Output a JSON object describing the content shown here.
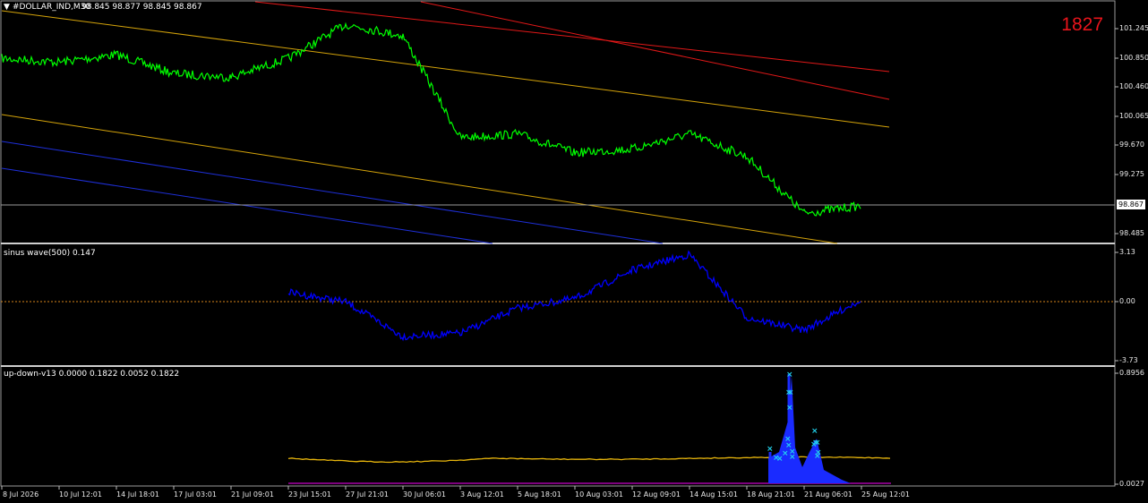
{
  "main_panel": {
    "title": "#DOLLAR_IND,M30",
    "ohlc": "98.845 98.877 98.845 98.867",
    "counter": "1827",
    "current_price": "98.867",
    "y_labels": [
      "101.245",
      "100.850",
      "100.460",
      "100.065",
      "99.670",
      "99.275",
      "98.485"
    ]
  },
  "indicator1": {
    "title": "sinus wave(500) 0.147",
    "y_labels": [
      "3.13",
      "0.00",
      "-3.73"
    ]
  },
  "indicator2": {
    "title": "up-down-v13 0.0000 0.1822 0.0052 0.1822",
    "y_labels": [
      "0.8956",
      "0.0027"
    ]
  },
  "x_axis": [
    "8 Jul 2026",
    "10 Jul 12:01",
    "14 Jul 18:01",
    "17 Jul 03:01",
    "21 Jul 09:01",
    "23 Jul 15:01",
    "27 Jul 21:01",
    "30 Jul 06:01",
    "3 Aug 12:01",
    "5 Aug 18:01",
    "10 Aug 03:01",
    "12 Aug 09:01",
    "14 Aug 15:01",
    "18 Aug 21:01",
    "21 Aug 06:01",
    "25 Aug 12:01"
  ],
  "chart_data": {
    "type": "line",
    "symbol": "#DOLLAR_IND",
    "timeframe": "M30",
    "x": [
      "8 Jul 2026",
      "10 Jul 12:01",
      "14 Jul 18:01",
      "17 Jul 03:01",
      "21 Jul 09:01",
      "23 Jul 15:01",
      "27 Jul 21:01",
      "30 Jul 06:01",
      "3 Aug 12:01",
      "5 Aug 18:01",
      "10 Aug 03:01",
      "12 Aug 09:01",
      "14 Aug 15:01",
      "18 Aug 21:01",
      "21 Aug 06:01",
      "25 Aug 12:01"
    ],
    "series": [
      {
        "values": [
          100.8,
          100.75,
          100.85,
          100.6,
          100.55,
          100.8,
          101.25,
          101.1,
          99.75,
          99.8,
          99.55,
          99.6,
          99.8,
          99.5,
          98.75,
          98.85
        ],
        "color": "#00ff00"
      }
    ],
    "ylim": [
      98.35,
      101.55
    ],
    "grid": false,
    "indicators": [
      {
        "name": "sinus wave(500)",
        "last": 0.147,
        "ylim": [
          -3.73,
          3.13
        ],
        "color": "#0000ff",
        "x": [
          "23 Jul 15:01",
          "27 Jul 21:01",
          "30 Jul 06:01",
          "3 Aug 12:01",
          "5 Aug 18:01",
          "10 Aug 03:01",
          "12 Aug 09:01",
          "14 Aug 15:01",
          "18 Aug 21:01",
          "21 Aug 06:01",
          "25 Aug 12:01"
        ],
        "values": [
          0.6,
          0.0,
          -2.2,
          -2.0,
          -0.4,
          0.2,
          2.0,
          3.0,
          -1.0,
          -1.8,
          0.147
        ]
      },
      {
        "name": "up-down-v13",
        "values_shown": [
          0.0,
          0.1822,
          0.0052,
          0.1822
        ],
        "ylim": [
          0.0027,
          0.8956
        ]
      }
    ]
  }
}
